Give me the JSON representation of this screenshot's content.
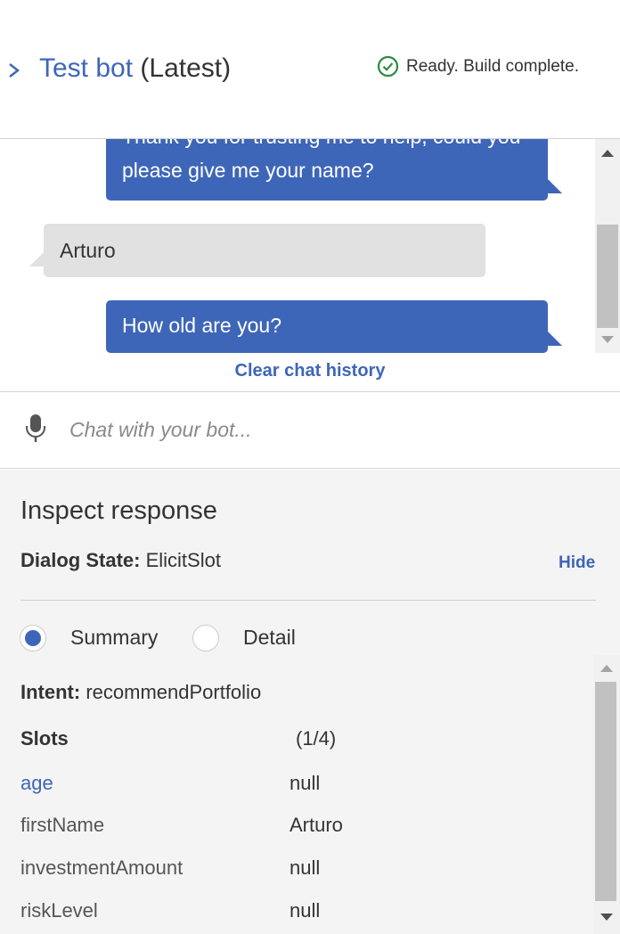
{
  "header": {
    "title_link": "Test bot",
    "title_suffix": " (Latest)",
    "status_text": "Ready. Build complete.",
    "status_color": "#2e8b3e",
    "accent_color": "#3e66b8"
  },
  "chat": {
    "messages": [
      {
        "from": "bot",
        "text": "Thank you for trusting me to help, could you please give me your name?"
      },
      {
        "from": "user",
        "text": "Arturo"
      },
      {
        "from": "bot",
        "text": "How old are you?"
      }
    ],
    "clear_label": "Clear chat history"
  },
  "input": {
    "placeholder": "Chat with your bot...",
    "icon": "microphone-icon"
  },
  "inspect": {
    "title": "Inspect response",
    "dialog_state_label": "Dialog State:",
    "dialog_state_value": " ElicitSlot",
    "hide_label": "Hide",
    "view_options": [
      {
        "label": "Summary",
        "selected": true
      },
      {
        "label": "Detail",
        "selected": false
      }
    ],
    "intent_label": "Intent:",
    "intent_value": " recommendPortfolio",
    "slots_label": "Slots",
    "slots_count": "(1/4)",
    "slots": [
      {
        "name": "age",
        "value": "null"
      },
      {
        "name": "firstName",
        "value": "Arturo"
      },
      {
        "name": "investmentAmount",
        "value": "null"
      },
      {
        "name": "riskLevel",
        "value": "null"
      }
    ]
  }
}
